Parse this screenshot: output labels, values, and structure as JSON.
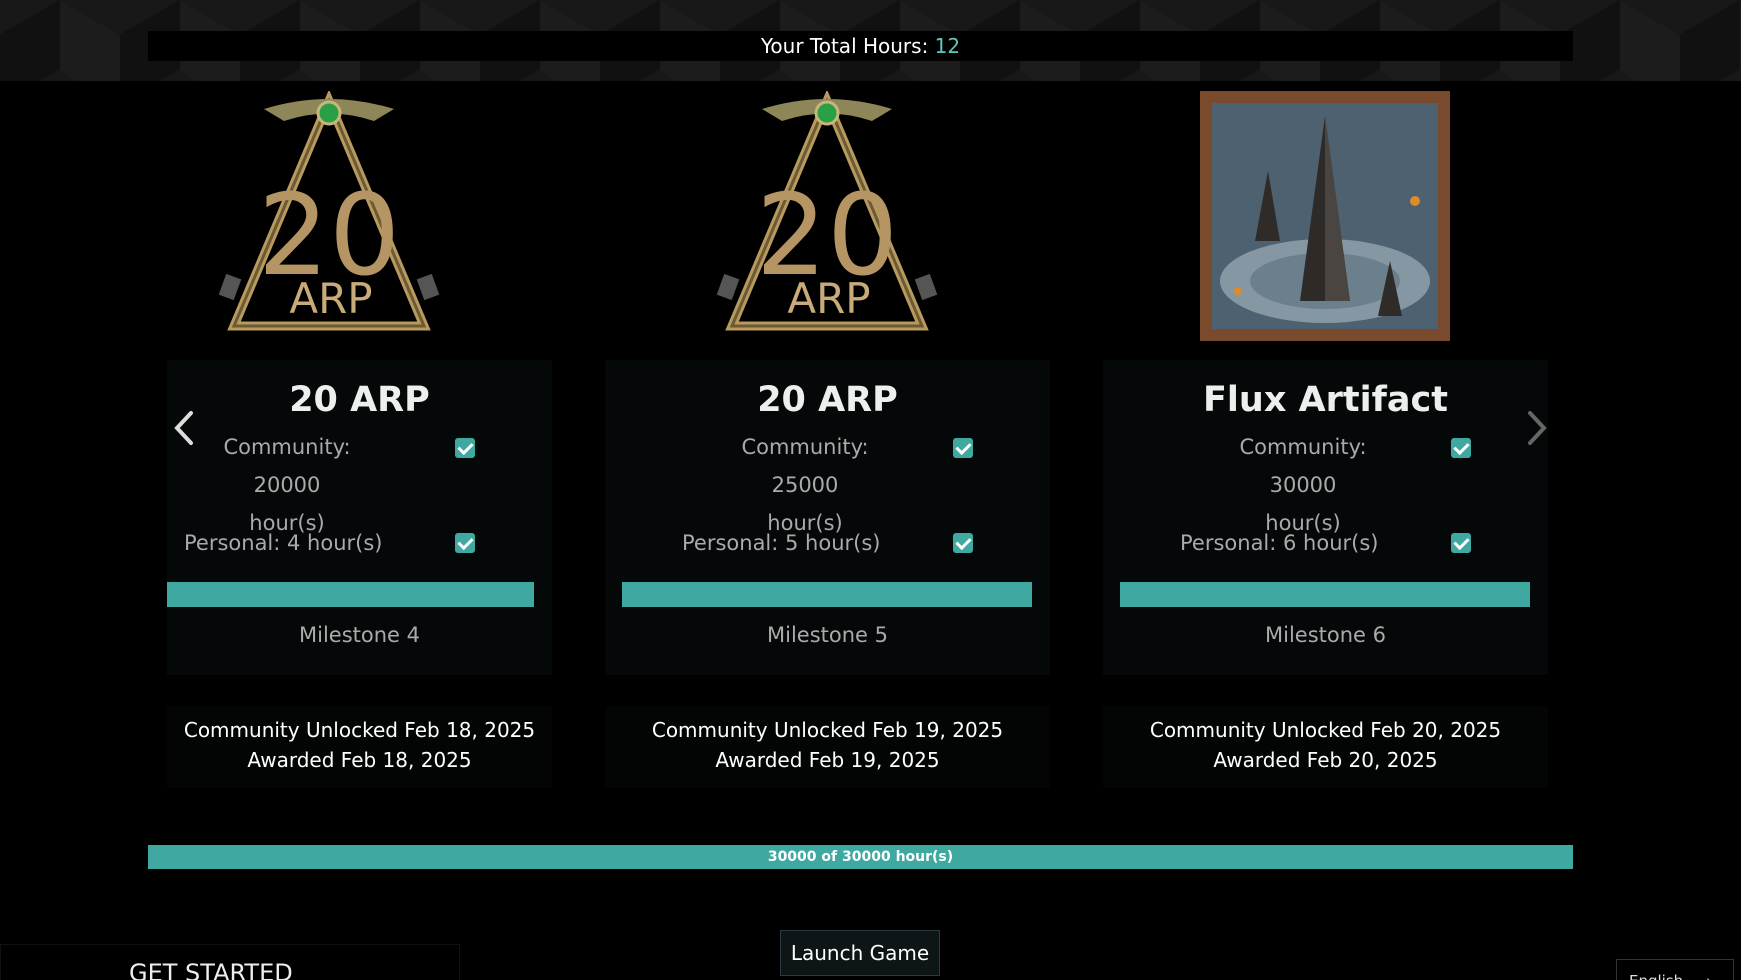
{
  "header": {
    "total_hours_label": "Your Total Hours: ",
    "total_hours_value": "12"
  },
  "cards": [
    {
      "title": "20 ARP",
      "community": "Community: 20000",
      "community_unit": "hour(s)",
      "personal": "Personal: 4 hour(s)",
      "milestone": "Milestone 4",
      "unlocked": "Community Unlocked Feb 18, 2025",
      "awarded": "Awarded Feb 18, 2025",
      "image_icon": "arp-20-emblem",
      "progress": 1.0
    },
    {
      "title": "20 ARP",
      "community": "Community: 25000",
      "community_unit": "hour(s)",
      "personal": "Personal: 5 hour(s)",
      "milestone": "Milestone 5",
      "unlocked": "Community Unlocked Feb 19, 2025",
      "awarded": "Awarded Feb 19, 2025",
      "image_icon": "arp-20-emblem",
      "progress": 1.0
    },
    {
      "title": "Flux Artifact",
      "community": "Community: 30000",
      "community_unit": "hour(s)",
      "personal": "Personal: 6 hour(s)",
      "milestone": "Milestone 6",
      "unlocked": "Community Unlocked Feb 20, 2025",
      "awarded": "Awarded Feb 20, 2025",
      "image_icon": "flux-artifact-image",
      "progress": 1.0
    }
  ],
  "community_progress": {
    "label": "30000 of 30000 hour(s)",
    "fraction": 1.0
  },
  "launch_button": "Launch Game",
  "footer": {
    "get_started": "GET STARTED",
    "language": "English"
  },
  "colors": {
    "accent": "#3fa8a0",
    "background": "#000000",
    "hours_value": "#5cc8c0"
  }
}
